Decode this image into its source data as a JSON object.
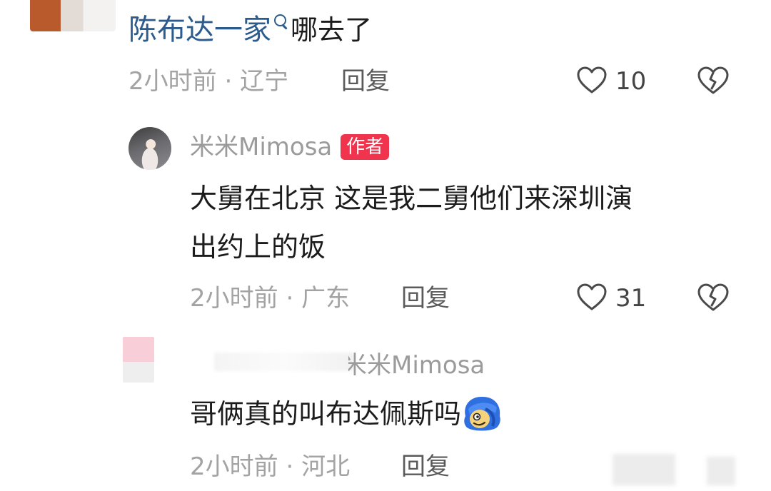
{
  "top_comment": {
    "mention": "陈布达一家",
    "text": "哪去了",
    "time": "2小时前",
    "location": "辽宁",
    "reply_label": "回复",
    "likes": "10"
  },
  "author_reply": {
    "username": "米米Mimosa",
    "badge": "作者",
    "line1": "大舅在北京 这是我二舅他们来深圳演",
    "line2": "出约上的饭",
    "time": "2小时前",
    "location": "广东",
    "reply_label": "回复",
    "likes": "31"
  },
  "bottom_reply": {
    "reply_to": "米米Mimosa",
    "text": "哥俩真的叫布达佩斯吗",
    "emoji": "blue-hair-emoji-icon",
    "time": "2小时前",
    "location": "河北",
    "reply_label": "回复"
  },
  "meta_separator": "·",
  "colors": {
    "mention": "#2c5b8e",
    "badge": "#f0344e",
    "meta": "#a3a3a3"
  }
}
